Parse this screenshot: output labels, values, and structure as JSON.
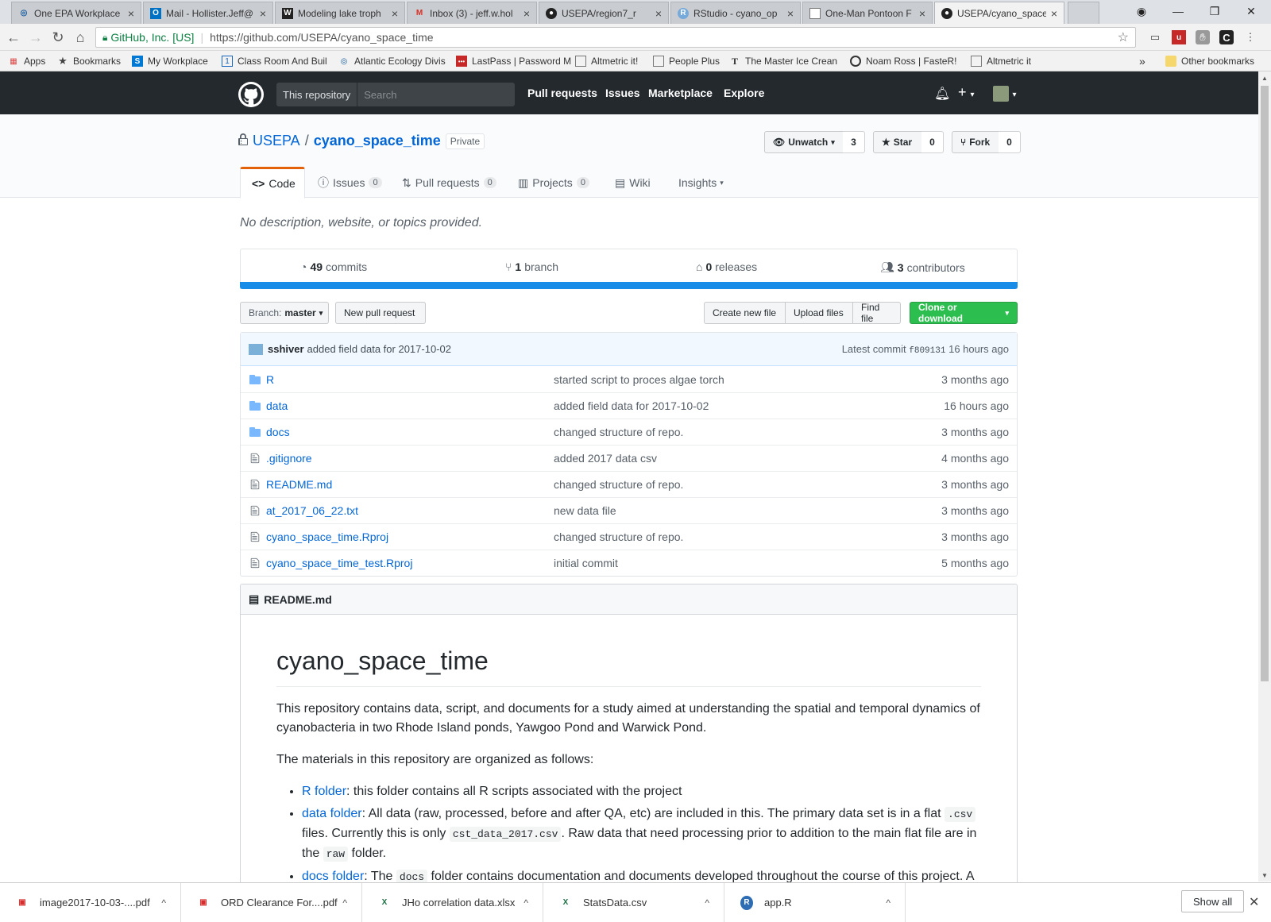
{
  "browser": {
    "tabs": [
      {
        "label": "One EPA Workplace",
        "icon": "epa-icon"
      },
      {
        "label": "Mail - Hollister.Jeff@",
        "icon": "outlook-icon"
      },
      {
        "label": "Modeling lake troph",
        "icon": "wikipedia-icon"
      },
      {
        "label": "Inbox (3) - jeff.w.hol",
        "icon": "gmail-icon"
      },
      {
        "label": "USEPA/region7_r",
        "icon": "github-icon"
      },
      {
        "label": "RStudio - cyano_op",
        "icon": "rstudio-icon"
      },
      {
        "label": "One-Man Pontoon F",
        "icon": "page-icon"
      },
      {
        "label": "USEPA/cyano_space",
        "icon": "github-icon"
      }
    ],
    "address": {
      "org": "GitHub, Inc. [US]",
      "url": "https://github.com/USEPA/cyano_space_time"
    },
    "bookmarks": [
      {
        "label": "Apps",
        "icon": "apps-grid-icon"
      },
      {
        "label": "Bookmarks",
        "icon": "star-icon"
      },
      {
        "label": "My Workplace",
        "icon": "sharepoint-icon"
      },
      {
        "label": "Class Room And Buil",
        "icon": "page-icon"
      },
      {
        "label": "Atlantic Ecology Divis",
        "icon": "epa-icon"
      },
      {
        "label": "LastPass | Password M",
        "icon": "lastpass-icon"
      },
      {
        "label": "Altmetric it!",
        "icon": "page-icon"
      },
      {
        "label": "People Plus",
        "icon": "page-icon"
      },
      {
        "label": "The Master Ice Crean",
        "icon": "nyt-icon"
      },
      {
        "label": "Noam Ross | FasteR!",
        "icon": "circle-icon"
      },
      {
        "label": "Altmetric it",
        "icon": "page-icon"
      }
    ],
    "other_bookmarks": "Other bookmarks",
    "overflow": "»"
  },
  "github": {
    "search_scope": "This repository",
    "search_placeholder": "Search",
    "nav": [
      "Pull requests",
      "Issues",
      "Marketplace",
      "Explore"
    ],
    "repo": {
      "owner": "USEPA",
      "slash": "/",
      "name": "cyano_space_time",
      "visibility": "Private"
    },
    "actions": {
      "watch_label": "Unwatch",
      "watch_count": "3",
      "star_label": "Star",
      "star_count": "0",
      "fork_label": "Fork",
      "fork_count": "0"
    },
    "tabs": [
      {
        "label": "Code",
        "count": ""
      },
      {
        "label": "Issues",
        "count": "0"
      },
      {
        "label": "Pull requests",
        "count": "0"
      },
      {
        "label": "Projects",
        "count": "0"
      },
      {
        "label": "Wiki",
        "count": ""
      },
      {
        "label": "Insights",
        "count": ""
      }
    ],
    "description": "No description, website, or topics provided.",
    "summary": {
      "commits_num": "49",
      "commits_label": "commits",
      "branches_num": "1",
      "branches_label": "branch",
      "releases_num": "0",
      "releases_label": "releases",
      "contributors_num": "3",
      "contributors_label": "contributors"
    },
    "lang_color": "#198ce7",
    "branch_prefix": "Branch:",
    "branch_name": "master",
    "buttons": {
      "new_pr": "New pull request",
      "create_file": "Create new file",
      "upload": "Upload files",
      "find": "Find file",
      "clone": "Clone or download"
    },
    "latest_commit": {
      "author": "sshiver",
      "message": "added field data for 2017-10-02",
      "prefix": "Latest commit",
      "sha": "f809131",
      "age": "16 hours ago"
    },
    "files": [
      {
        "name": "R",
        "type": "dir",
        "message": "started script to proces algae torch",
        "age": "3 months ago"
      },
      {
        "name": "data",
        "type": "dir",
        "message": "added field data for 2017-10-02",
        "age": "16 hours ago"
      },
      {
        "name": "docs",
        "type": "dir",
        "message": "changed structure of repo.",
        "age": "3 months ago"
      },
      {
        "name": ".gitignore",
        "type": "file",
        "message": "added 2017 data csv",
        "age": "4 months ago"
      },
      {
        "name": "README.md",
        "type": "file",
        "message": "changed structure of repo.",
        "age": "3 months ago"
      },
      {
        "name": "at_2017_06_22.txt",
        "type": "file",
        "message": "new data file",
        "age": "3 months ago"
      },
      {
        "name": "cyano_space_time.Rproj",
        "type": "file",
        "message": "changed structure of repo.",
        "age": "3 months ago"
      },
      {
        "name": "cyano_space_time_test.Rproj",
        "type": "file",
        "message": "initial commit",
        "age": "5 months ago"
      }
    ],
    "readme": {
      "filename": "README.md",
      "title": "cyano_space_time",
      "intro": "This repository contains data, script, and documents for a study aimed at understanding the spatial and temporal dynamics of cyanobacteria in two Rhode Island ponds, Yawgoo Pond and Warwick Pond.",
      "organized": "The materials in this repository are organized as follows:",
      "b1_link": "R folder",
      "b1_text": ": this folder contains all R scripts associated with the project",
      "b2_link": "data folder",
      "b2_t1": ": All data (raw, processed, before and after QA, etc) are included in this. The primary data set is in a flat ",
      "b2_c1": ".csv",
      "b2_t2": " files. Currently this is only ",
      "b2_c2": "cst_data_2017.csv",
      "b2_t3": ". Raw data that need processing prior to addition to the main flat file are in the ",
      "b2_c3": "raw",
      "b2_t4": " folder.",
      "b3_link": "docs folder",
      "b3_t1": ": The ",
      "b3_c1": "docs",
      "b3_t2": " folder contains documentation and documents developed throughout the course of this project. A"
    }
  },
  "downloads": {
    "items": [
      {
        "label": "image2017-10-03-....pdf",
        "icon": "pdf-icon"
      },
      {
        "label": "ORD Clearance For....pdf",
        "icon": "pdf-icon"
      },
      {
        "label": "JHo correlation data.xlsx",
        "icon": "excel-icon"
      },
      {
        "label": "StatsData.csv",
        "icon": "excel-icon"
      },
      {
        "label": "app.R",
        "icon": "r-file-icon"
      }
    ],
    "show_all": "Show all"
  }
}
